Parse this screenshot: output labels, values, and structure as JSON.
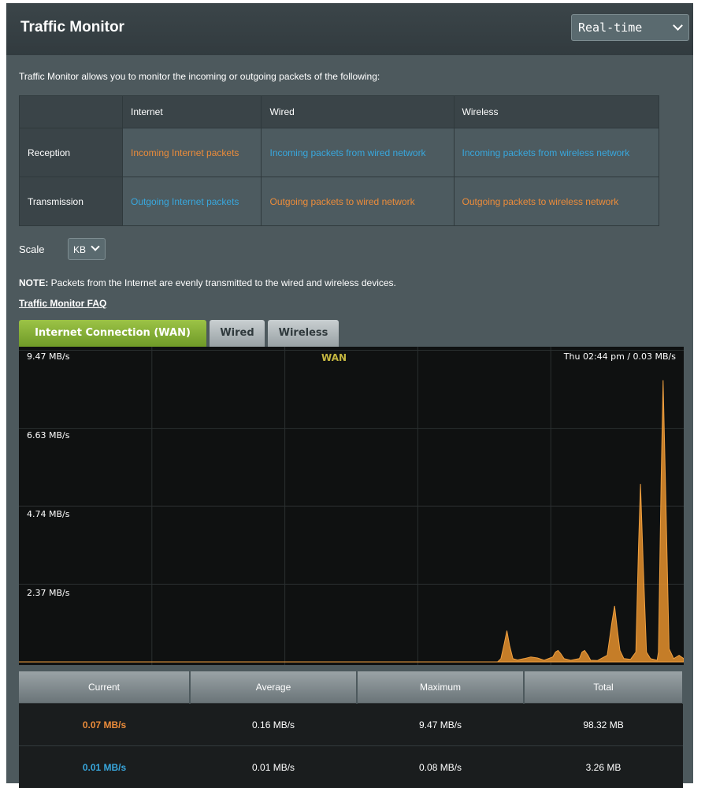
{
  "header": {
    "title": "Traffic Monitor",
    "mode_select": "Real-time"
  },
  "description": "Traffic Monitor allows you to monitor the incoming or outgoing packets of the following:",
  "info_table": {
    "columns": [
      "Internet",
      "Wired",
      "Wireless"
    ],
    "rows": [
      {
        "label": "Reception",
        "cells": [
          {
            "text": "Incoming Internet packets",
            "color": "orange"
          },
          {
            "text": "Incoming packets from wired network",
            "color": "blue"
          },
          {
            "text": "Incoming packets from wireless network",
            "color": "blue"
          }
        ]
      },
      {
        "label": "Transmission",
        "cells": [
          {
            "text": "Outgoing Internet packets",
            "color": "blue"
          },
          {
            "text": "Outgoing packets to wired network",
            "color": "orange"
          },
          {
            "text": "Outgoing packets to wireless network",
            "color": "orange"
          }
        ]
      }
    ]
  },
  "scale": {
    "label": "Scale",
    "value": "KB"
  },
  "note": {
    "prefix": "NOTE:",
    "text": " Packets from the Internet are evenly transmitted to the wired and wireless devices."
  },
  "faq_link": "Traffic Monitor FAQ",
  "tabs": [
    {
      "label": "Internet Connection (WAN)",
      "active": true
    },
    {
      "label": "Wired",
      "active": false
    },
    {
      "label": "Wireless",
      "active": false
    }
  ],
  "chart_data": {
    "type": "area",
    "title": "WAN",
    "readout": "Thu 02:44 pm / 0.03 MB/s",
    "y_tick_labels": [
      "9.47 MB/s",
      "6.63 MB/s",
      "4.74 MB/s",
      "2.37 MB/s"
    ],
    "ylim": [
      0,
      9.47
    ],
    "y_grid": [
      9.47,
      7.1,
      4.74,
      2.37
    ],
    "grid": true,
    "series": [
      {
        "color": "#d98a2b",
        "x": [
          0,
          72,
          72.5,
          73,
          73.4,
          73.8,
          74.3,
          75,
          76,
          77,
          78,
          79,
          80.3,
          80.7,
          81.1,
          81.5,
          82,
          83,
          84.3,
          84.7,
          85.1,
          85.6,
          86,
          87,
          88.5,
          89.2,
          89.6,
          90,
          90.4,
          91,
          92,
          92.8,
          93.2,
          93.5,
          93.9,
          94.4,
          95,
          96,
          96.2,
          96.6,
          96.9,
          97.3,
          97.8,
          98.5,
          99.3,
          100
        ],
        "values": [
          0,
          0,
          0.1,
          0.55,
          0.95,
          0.5,
          0.1,
          0.06,
          0.1,
          0.15,
          0.12,
          0.05,
          0.15,
          0.3,
          0.35,
          0.25,
          0.1,
          0.05,
          0.1,
          0.3,
          0.35,
          0.2,
          0.05,
          0.04,
          0.2,
          1.2,
          1.7,
          1.0,
          0.35,
          0.1,
          0.08,
          0.3,
          3.5,
          5.4,
          3.0,
          0.3,
          0.1,
          0.05,
          0.3,
          5.5,
          8.55,
          5.0,
          0.4,
          0.1,
          0.2,
          0.1
        ]
      }
    ]
  },
  "stats": {
    "headers": [
      "Current",
      "Average",
      "Maximum",
      "Total"
    ],
    "rows": [
      {
        "values": [
          "0.07 MB/s",
          "0.16 MB/s",
          "9.47 MB/s",
          "98.32 MB"
        ],
        "color": "orange"
      },
      {
        "values": [
          "0.01 MB/s",
          "0.01 MB/s",
          "0.08 MB/s",
          "3.26 MB"
        ],
        "color": "blue"
      }
    ]
  }
}
